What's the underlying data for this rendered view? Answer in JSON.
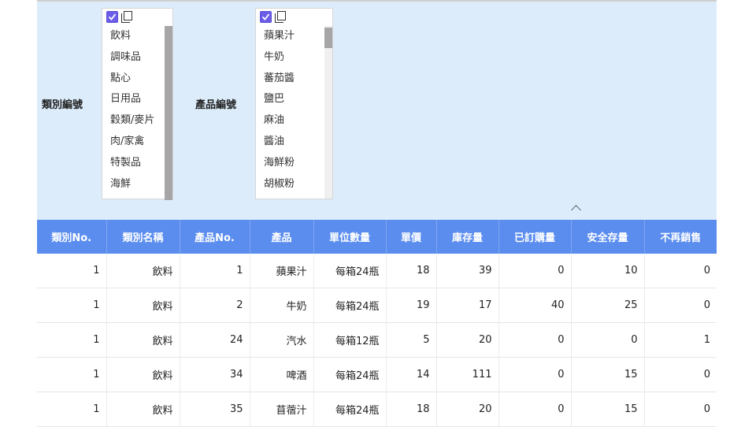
{
  "filters": {
    "category": {
      "label": "類別編號",
      "items": [
        "飲料",
        "調味品",
        "點心",
        "日用品",
        "穀類/麥片",
        "肉/家禽",
        "特製品",
        "海鮮"
      ]
    },
    "product": {
      "label": "產品編號",
      "items": [
        "蘋果汁",
        "牛奶",
        "蕃茄醬",
        "鹽巴",
        "麻油",
        "醬油",
        "海鮮粉",
        "胡椒粉"
      ]
    }
  },
  "table": {
    "columns": [
      "類別No.",
      "類別名稱",
      "產品No.",
      "產品",
      "單位數量",
      "單價",
      "庫存量",
      "已訂購量",
      "安全存量",
      "不再銷售"
    ],
    "rows": [
      [
        "1",
        "飲料",
        "1",
        "蘋果汁",
        "每箱24瓶",
        "18",
        "39",
        "0",
        "10",
        "0"
      ],
      [
        "1",
        "飲料",
        "2",
        "牛奶",
        "每箱24瓶",
        "19",
        "17",
        "40",
        "25",
        "0"
      ],
      [
        "1",
        "飲料",
        "24",
        "汽水",
        "每箱12瓶",
        "5",
        "20",
        "0",
        "0",
        "1"
      ],
      [
        "1",
        "飲料",
        "34",
        "啤酒",
        "每箱24瓶",
        "14",
        "111",
        "0",
        "15",
        "0"
      ],
      [
        "1",
        "飲料",
        "35",
        "苜蓿汁",
        "每箱24瓶",
        "18",
        "20",
        "0",
        "15",
        "0"
      ]
    ]
  },
  "colors": {
    "panel_bg": "#dcecfb",
    "header_bg": "#5b8def",
    "check_accent": "#6b5de8"
  },
  "icons": {
    "select_all": "check-all-icon",
    "deselect_all": "copy-icon",
    "collapse": "chevron-up-icon"
  }
}
